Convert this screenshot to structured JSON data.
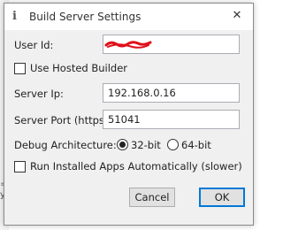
{
  "dialog": {
    "title": "Build Server Settings",
    "title_icon": "info-icon",
    "close_glyph": "✕"
  },
  "fields": {
    "user_id": {
      "label": "User Id:",
      "value": ""
    },
    "use_hosted_builder": {
      "label": "Use Hosted Builder",
      "checked": false
    },
    "server_ip": {
      "label": "Server Ip:",
      "value": "192.168.0.16"
    },
    "server_port": {
      "label": "Server Port (https):",
      "value": "51041"
    }
  },
  "debug_architecture": {
    "label": "Debug Architecture:",
    "options": [
      {
        "label": "32-bit",
        "selected": true
      },
      {
        "label": "64-bit",
        "selected": false
      }
    ]
  },
  "run_installed_apps": {
    "label": "Run Installed Apps Automatically (slower)",
    "checked": false
  },
  "buttons": {
    "cancel": "Cancel",
    "ok": "OK"
  },
  "colors": {
    "redaction": "#e0101a",
    "accent": "#0078d7"
  }
}
